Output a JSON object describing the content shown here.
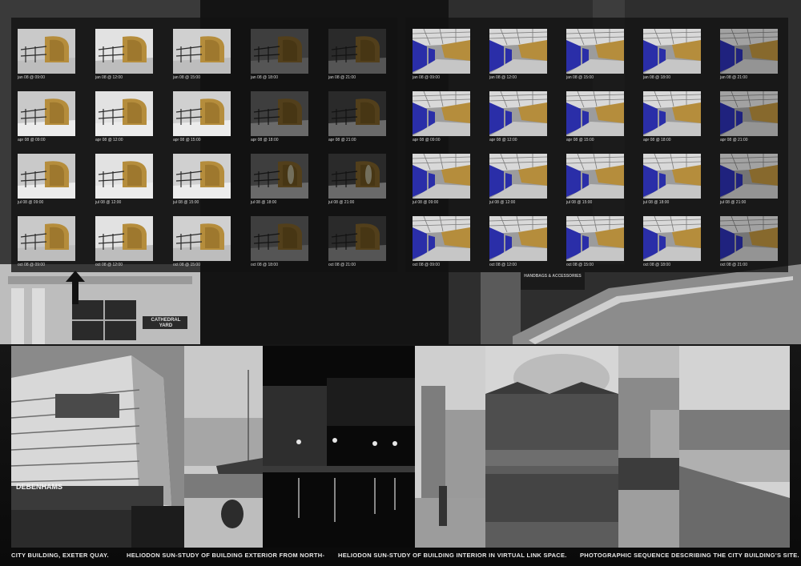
{
  "background": {
    "signs": [
      {
        "text": "CATHEDRAL YARD"
      },
      {
        "text": "HANDBAGS & ACCESSORIES"
      }
    ]
  },
  "exterior_study": {
    "labels": [
      "jan 08 @ 09:00",
      "jan 08 @ 12:00",
      "jan 08 @ 15:00",
      "jan 08 @ 18:00",
      "jan 08 @ 21:00",
      "apr 08 @ 09:00",
      "apr 08 @ 12:00",
      "apr 08 @ 15:00",
      "apr 08 @ 18:00",
      "apr 08 @ 21:00",
      "jul 08 @ 09:00",
      "jul 08 @ 12:00",
      "jul 08 @ 15:00",
      "jul 08 @ 18:00",
      "jul 08 @ 21:00",
      "oct 08 @ 09:00",
      "oct 08 @ 12:00",
      "oct 08 @ 15:00",
      "oct 08 @ 18:00",
      "oct 08 @ 21:00"
    ]
  },
  "interior_study": {
    "labels": [
      "jan 08 @ 09:00",
      "jan 08 @ 12:00",
      "jan 08 @ 15:00",
      "jan 08 @ 18:00",
      "jan 08 @ 21:00",
      "apr 08 @ 09:00",
      "apr 08 @ 12:00",
      "apr 08 @ 15:00",
      "apr 08 @ 18:00",
      "apr 08 @ 21:00",
      "jul 08 @ 09:00",
      "jul 08 @ 12:00",
      "jul 08 @ 15:00",
      "jul 08 @ 18:00",
      "jul 08 @ 21:00",
      "oct 08 @ 09:00",
      "oct 08 @ 12:00",
      "oct 08 @ 15:00",
      "oct 08 @ 18:00",
      "oct 08 @ 21:00"
    ]
  },
  "photos": {
    "debenhams_sign": "DEBENHAMS"
  },
  "captions": [
    "CITY BUILDING, EXETER QUAY.",
    "HELIODON SUN-STUDY OF BUILDING EXTERIOR FROM NORTH-",
    "HELIODON SUN-STUDY OF BUILDING INTERIOR IN VIRTUAL LINK SPACE.",
    "PHOTOGRAPHIC SEQUENCE DESCRIBING THE CITY BUILDING'S SITE."
  ],
  "colors": {
    "wood": "#b58d3c",
    "interior_blue": "#2a2ea8",
    "panel": "#121212"
  }
}
